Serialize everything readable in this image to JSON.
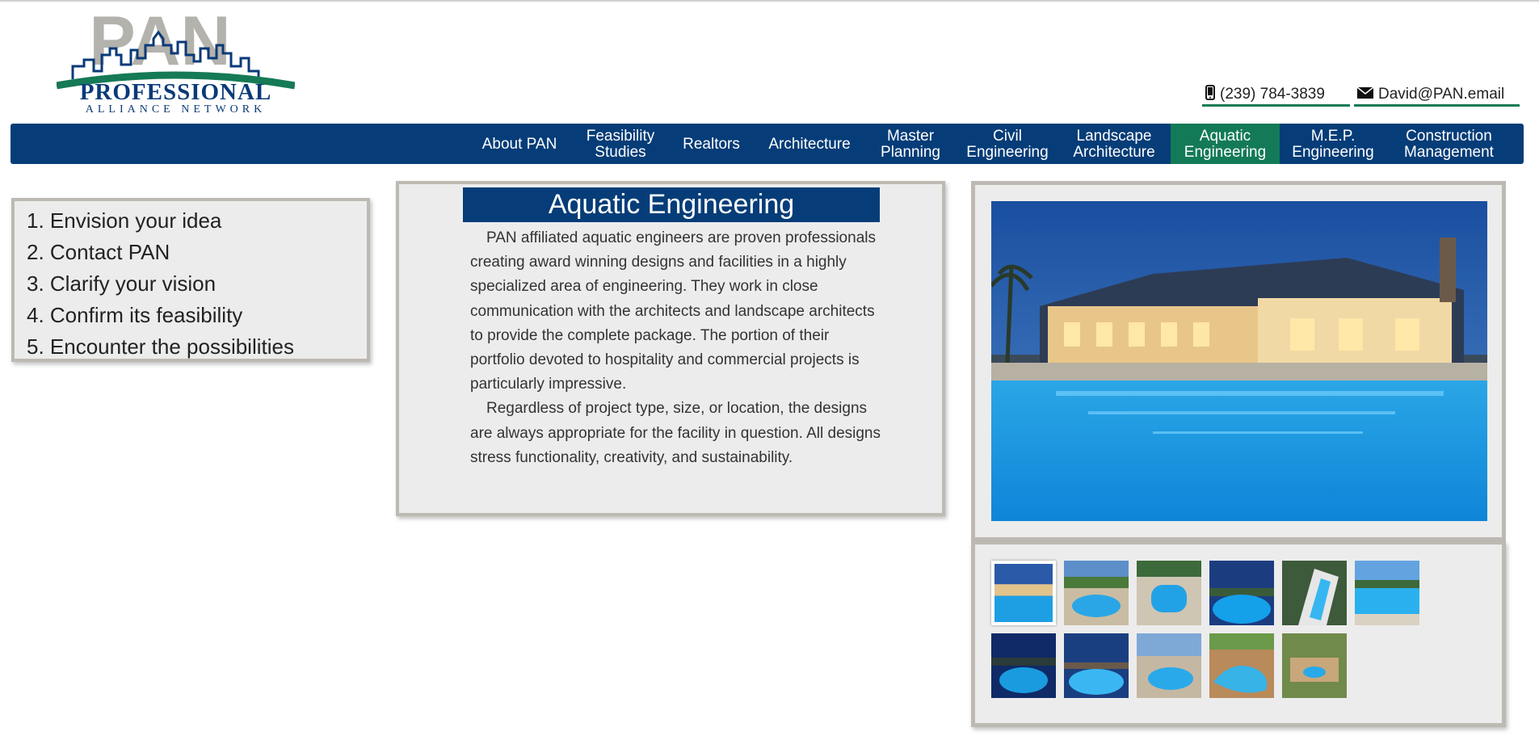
{
  "logo": {
    "letters": "PAN",
    "line1": "PROFESSIONAL",
    "line2": "ALLIANCE NETWORK"
  },
  "contact": {
    "phone_icon": "phone-icon",
    "phone": "(239) 784-3839",
    "email_icon": "envelope-icon",
    "email": "David@PAN.email"
  },
  "colors": {
    "nav_bg": "#063d78",
    "nav_active": "#137a57",
    "panel_bg": "#ececec",
    "panel_border": "#bdbab3"
  },
  "nav": {
    "items": [
      {
        "line1": "About PAN",
        "line2": ""
      },
      {
        "line1": "Feasibility",
        "line2": "Studies"
      },
      {
        "line1": "Realtors",
        "line2": ""
      },
      {
        "line1": "Architecture",
        "line2": ""
      },
      {
        "line1": "Master",
        "line2": "Planning"
      },
      {
        "line1": "Civil",
        "line2": "Engineering"
      },
      {
        "line1": "Landscape",
        "line2": "Architecture"
      },
      {
        "line1": "Aquatic",
        "line2": "Engineering"
      },
      {
        "line1": "M.E.P.",
        "line2": "Engineering"
      },
      {
        "line1": "Construction",
        "line2": "Management"
      }
    ],
    "active": "Aquatic Engineering"
  },
  "steps": [
    "1. Envision your idea",
    "2. Contact PAN",
    "3. Clarify your vision",
    "4. Confirm its feasibility",
    "5. Encounter the possibilities"
  ],
  "card": {
    "title": "Aquatic Engineering",
    "p1": "PAN affiliated aquatic engineers are proven professionals creating award winning designs and facilities in a highly specialized area of engineering. They work in close communication with the architects and landscape architects to provide the complete package. The portion of their portfolio devoted to hospitality and commercial projects is particularly impressive.",
    "p2": "Regardless of project type, size, or location, the designs are always appropriate for the facility in question. All designs stress functionality, creativity, and sustainability."
  },
  "gallery": {
    "thumb_count": 11,
    "selected_index": 0
  }
}
